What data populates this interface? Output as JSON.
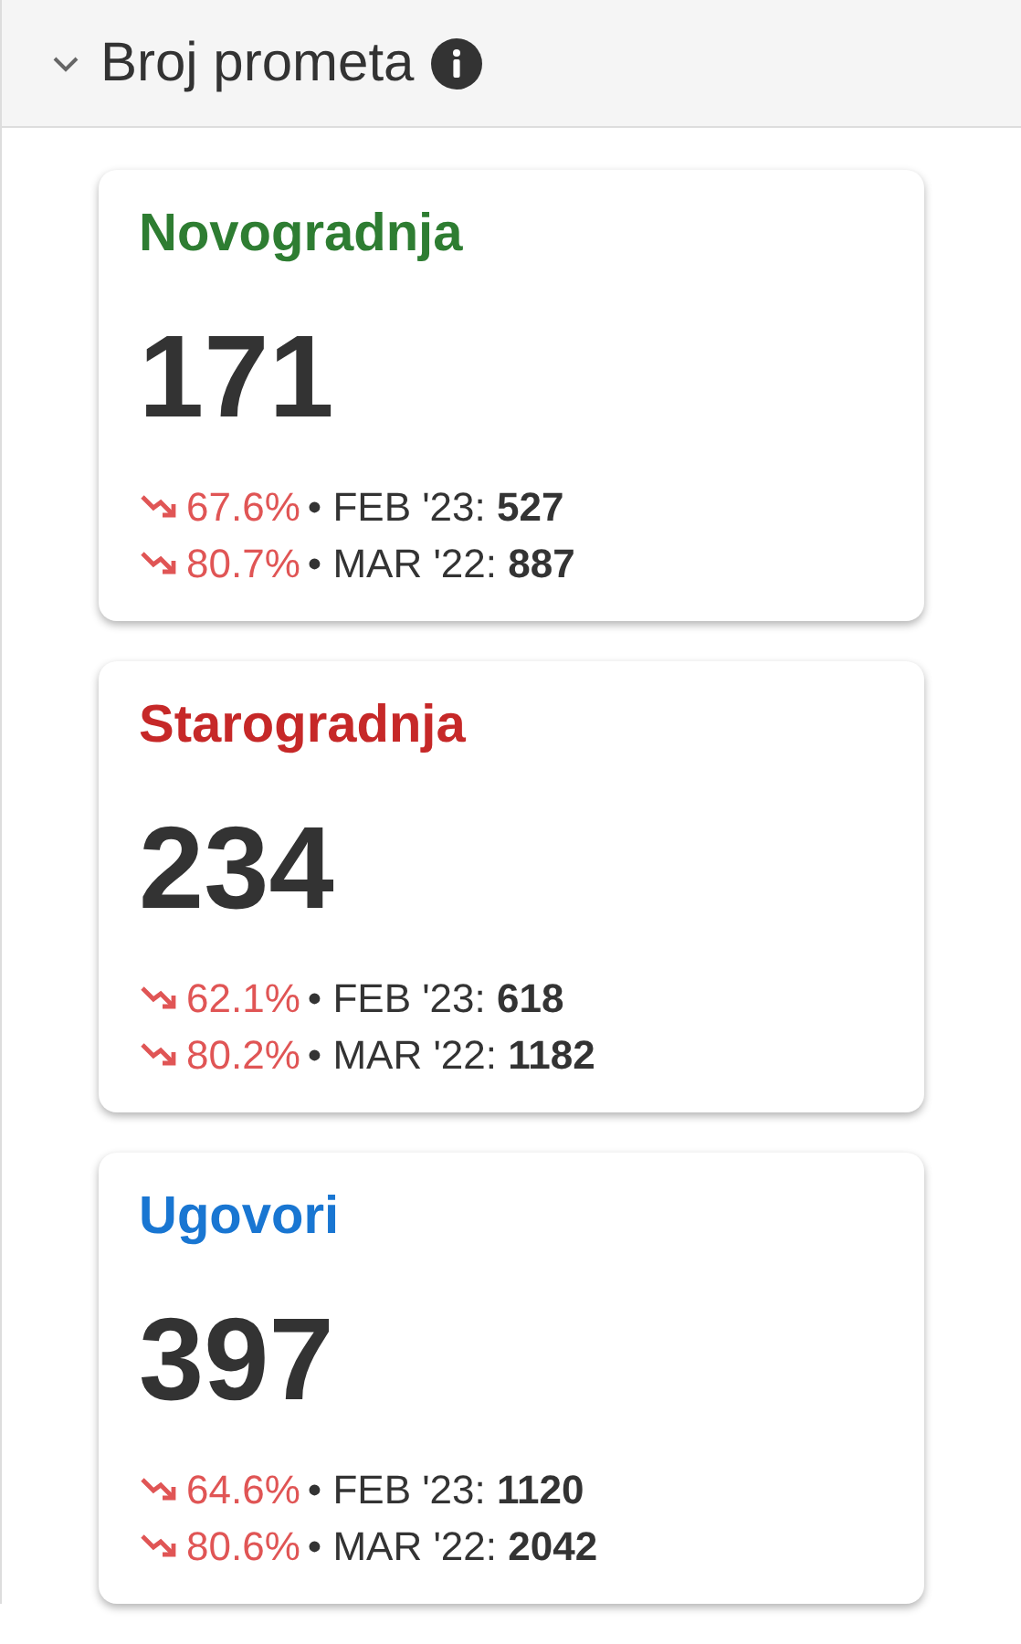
{
  "section": {
    "title": "Broj prometa",
    "expanded": true
  },
  "cards": [
    {
      "title": "Novogradnja",
      "color": "#2e7d32",
      "value": "171",
      "comparisons": [
        {
          "kind": "decrease",
          "change": "67.6%",
          "text": "• FEB '23: **527**"
        },
        {
          "kind": "decrease",
          "change": "80.7%",
          "text": "• MAR '22: **887**"
        }
      ]
    },
    {
      "title": "Starogradnja",
      "color": "#c62828",
      "value": "234",
      "comparisons": [
        {
          "kind": "decrease",
          "change": "62.1%",
          "text": "• FEB '23: **618**"
        },
        {
          "kind": "decrease",
          "change": "80.2%",
          "text": "• MAR '22: **1182**"
        }
      ]
    },
    {
      "title": "Ugovori",
      "color": "#1976d2",
      "value": "397",
      "comparisons": [
        {
          "kind": "decrease",
          "change": "64.6%",
          "text": "• FEB '23: **1120**"
        },
        {
          "kind": "decrease",
          "change": "80.6%",
          "text": "• MAR '22: **2042**"
        }
      ]
    }
  ]
}
